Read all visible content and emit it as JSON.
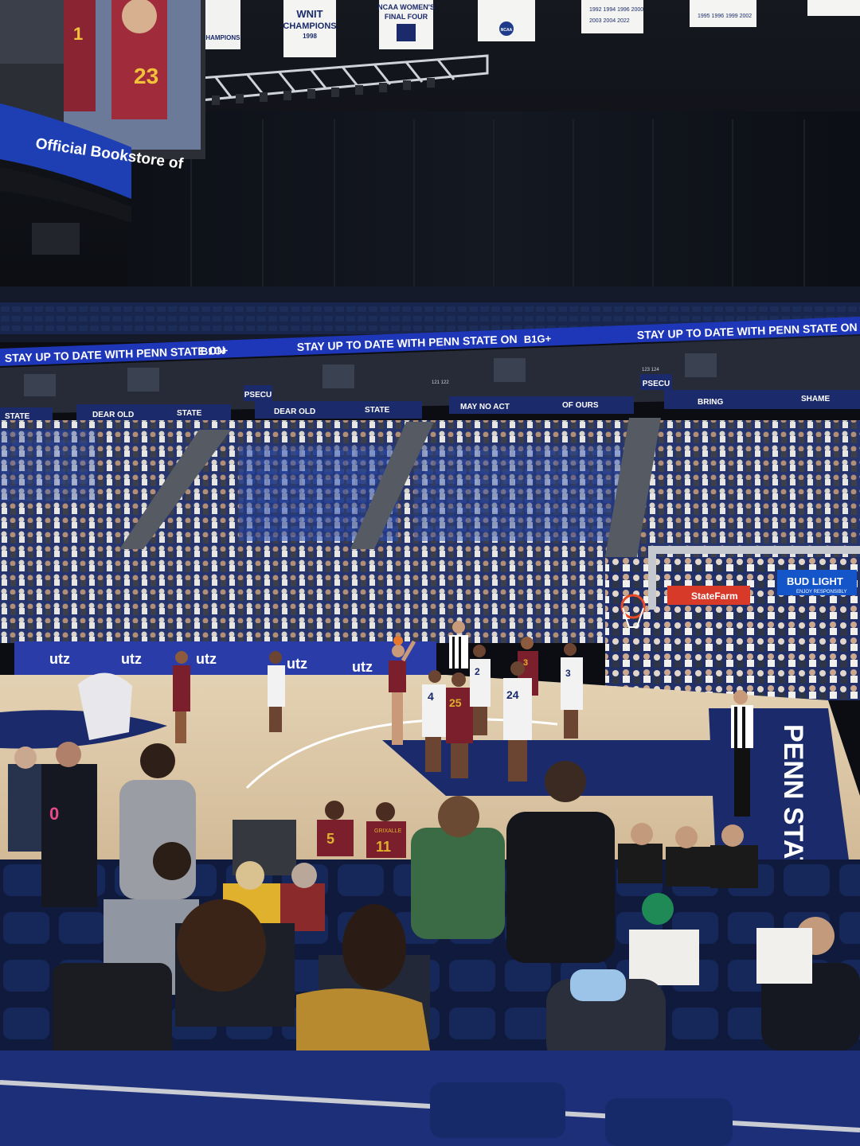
{
  "banners": {
    "wnit_line1": "WNIT",
    "wnit_line2": "CHAMPIONS",
    "wnit_year": "1998",
    "ncaa_line1": "NCAA WOMEN'S",
    "ncaa_line2": "FINAL FOUR",
    "left_partial": "CHAMPIONS",
    "ncaa_logo": "NCAA",
    "years_a": [
      "1992",
      "1994",
      "1996",
      "2000"
    ],
    "years_b": [
      "2003",
      "2004",
      "2022"
    ],
    "years_c": [
      "1995",
      "1996",
      "1999",
      "2002"
    ]
  },
  "scoreboard": {
    "ribbon_text": "Official Bookstore of",
    "jersey_numbers": [
      "1",
      "23"
    ]
  },
  "ribbon": {
    "message": "STAY UP TO DATE WITH PENN STATE ON",
    "logo": "B1G+"
  },
  "suite_signs": [
    "PSECU",
    "PSECU",
    "121  122",
    "123  124"
  ],
  "fascia_words": [
    "STATE",
    "DEAR OLD",
    "STATE",
    "DEAR OLD",
    "STATE",
    "MAY NO ACT",
    "OF OURS",
    "BRING",
    "SHAME"
  ],
  "courtside": {
    "sponsor": "utz",
    "sponsor_repeat": 5
  },
  "sponsor_signs": {
    "bud_light": "BUD LIGHT",
    "bud_light_tag": "ENJOY RESPONSIBLY",
    "state_farm": "StateFarm"
  },
  "court": {
    "baseline_text": "PENN STATE"
  },
  "players": {
    "numbers": [
      "4",
      "25",
      "2",
      "3",
      "24",
      "3",
      "5",
      "11",
      "0"
    ],
    "name_bar": "GRIXALLE"
  },
  "colors": {
    "penn_navy": "#1b2a6b",
    "ribbon_blue": "#1e37b8",
    "court_wood": "#d8c3a1",
    "maroon": "#7a1f2b",
    "gold": "#e0b12d"
  }
}
